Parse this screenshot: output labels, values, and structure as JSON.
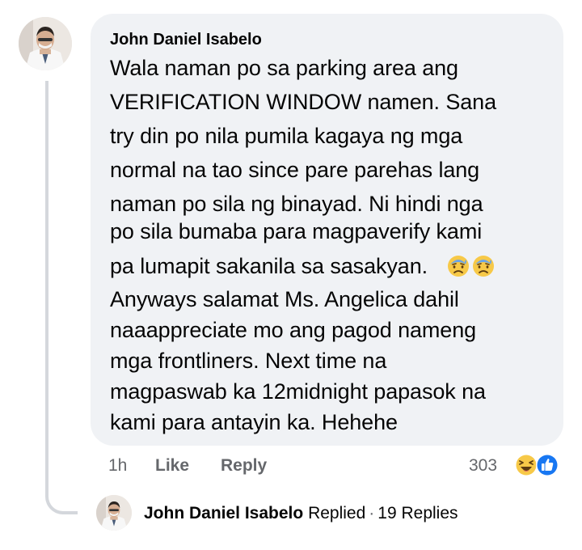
{
  "comment": {
    "author": "John Daniel Isabelo",
    "lines": [
      "Wala naman po sa parking area ang",
      "VERIFICATION WINDOW namen. Sana",
      "try din po nila pumila kagaya ng mga",
      "normal na tao since pare parehas lang",
      "naman po sila ng binayad. Ni hindi nga",
      "po sila bumaba para magpaverify kami",
      "pa lumapit sakanila sa sasakyan.",
      "Anyways salamat Ms. Angelica dahil",
      "naaappreciate mo ang pagod nameng",
      "mga frontliners. Next time na",
      "magpaswab ka 12midnight papasok na",
      "kami para antayin ka. Hehehe"
    ],
    "inline_emojis": [
      "downcast-face-with-sweat-icon",
      "downcast-face-with-sweat-icon"
    ],
    "time": "1h",
    "like_label": "Like",
    "reply_label": "Reply",
    "reaction_count": "303",
    "reaction_icons": [
      "haha-icon",
      "like-icon"
    ]
  },
  "replies": {
    "author": "John Daniel Isabelo",
    "replied_label": "Replied",
    "separator": "·",
    "count_label": "19 Replies"
  },
  "colors": {
    "bubble": "#f0f2f5",
    "text": "#050505",
    "muted": "#65676b",
    "like_blue": "#1877f2",
    "haha_yellow": "#f7c948",
    "thread_line": "#d4d7dc"
  }
}
